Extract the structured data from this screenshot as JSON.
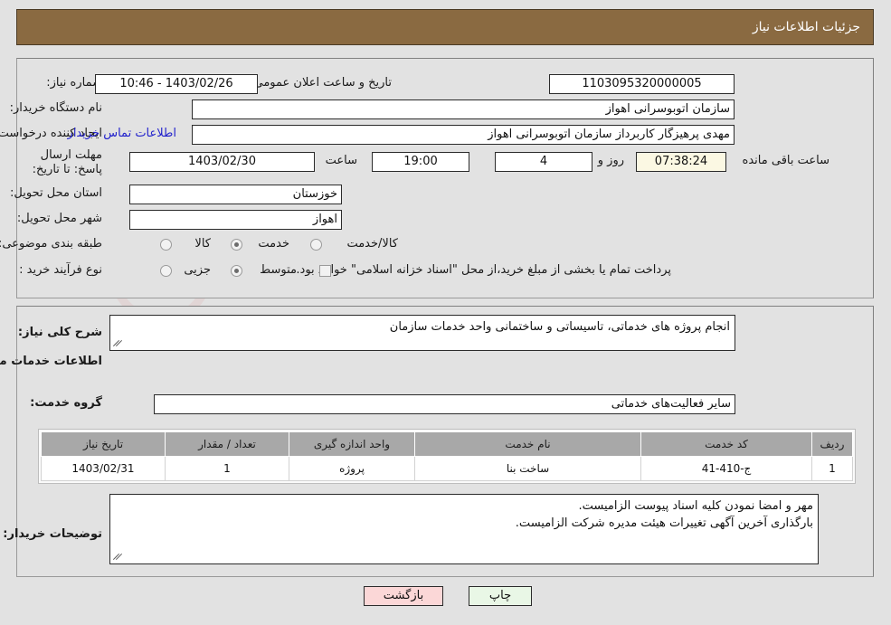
{
  "header": {
    "title": "جزئیات اطلاعات نیاز",
    "bar_color": "#8a6a41"
  },
  "watermark": {
    "text": "AnaTender.net"
  },
  "form": {
    "need_number_label": "شماره نیاز:",
    "need_number_value": "1103095320000005",
    "announce_datetime_label": "تاریخ و ساعت اعلان عمومی:",
    "announce_datetime_value": "1403/02/26 - 10:46",
    "buyer_org_label": "نام دستگاه خریدار:",
    "buyer_org_value": "سازمان اتوبوسرانی اهواز",
    "requester_label": "ایجاد کننده درخواست:",
    "requester_value": "مهدی پرهیزگار کاربرداز سازمان اتوبوسرانی اهواز",
    "contact_link": "اطلاعات تماس خریدار",
    "deadline_label": "مهلت ارسال پاسخ: تا تاریخ:",
    "deadline_date": "1403/02/30",
    "time_label": "ساعت",
    "deadline_time": "19:00",
    "days_remaining": "4",
    "days_word": "روز و",
    "countdown": "07:38:24",
    "remaining_suffix": "ساعت باقی مانده",
    "province_label": "استان محل تحویل:",
    "province_value": "خوزستان",
    "city_label": "شهر محل تحویل:",
    "city_value": "اهواز",
    "category_label": "طبقه بندی موضوعی:",
    "category_options": [
      {
        "label": "کالا",
        "selected": false
      },
      {
        "label": "خدمت",
        "selected": true
      },
      {
        "label": "کالا/خدمت",
        "selected": false
      }
    ],
    "process_label": "نوع فرآیند خرید :",
    "process_options": [
      {
        "label": "جزیی",
        "selected": false
      },
      {
        "label": "متوسط",
        "selected": true
      }
    ],
    "treasury_checkbox_label": "پرداخت تمام یا بخشی از مبلغ خرید،از محل \"اسناد خزانه اسلامی\" خواهد بود.",
    "treasury_checked": false
  },
  "description": {
    "general_label": "شرح کلی نیاز:",
    "general_value": "انجام پروژه های خدماتی، تاسیساتی و ساختمانی واحد خدمات سازمان",
    "services_section_title": "اطلاعات خدمات مورد نیاز",
    "service_group_label": "گروه خدمت:",
    "service_group_value": "سایر فعالیت‌های خدماتی"
  },
  "table": {
    "headers": [
      "ردیف",
      "کد خدمت",
      "نام خدمت",
      "واحد اندازه گیری",
      "تعداد / مقدار",
      "تاریخ نیاز"
    ],
    "rows": [
      {
        "row": "1",
        "service_code": "ج-410-41",
        "service_name": "ساخت بنا",
        "unit": "پروژه",
        "quantity": "1",
        "need_date": "1403/02/31"
      }
    ]
  },
  "buyer_notes": {
    "label": "توضیحات خریدار:",
    "lines": [
      "مهر و امضا نمودن کلیه اسناد پیوست الزامیست.",
      "بارگذاری آخرین آگهی تغییرات هیئت مدیره شرکت الزامیست."
    ]
  },
  "footer": {
    "print_label": "چاپ",
    "back_label": "بازگشت"
  }
}
